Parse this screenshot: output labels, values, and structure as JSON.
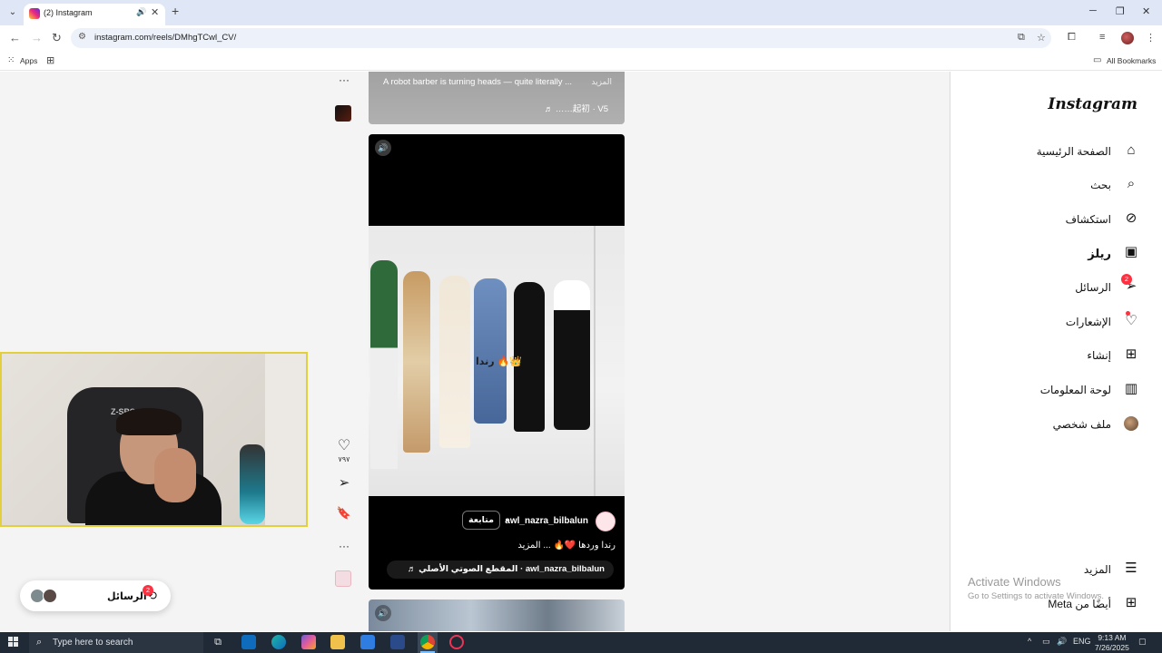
{
  "browser": {
    "tab_list_icon": "⌄",
    "tab_title": "(2) Instagram",
    "tab_audio_icon": "🔊",
    "tab_close": "✕",
    "new_tab": "+",
    "url": "instagram.com/reels/DMhgTCwl_CV/",
    "bookmarks": {
      "apps": "Apps",
      "all_bookmarks": "All Bookmarks"
    }
  },
  "sidebar": {
    "logo": "Instagram",
    "items": [
      {
        "label": "الصفحة الرئيسية",
        "icon": "home-icon",
        "glyph": "⌂"
      },
      {
        "label": "بحث",
        "icon": "search-icon",
        "glyph": "⌕"
      },
      {
        "label": "استكشاف",
        "icon": "compass-icon",
        "glyph": "⊘"
      },
      {
        "label": "ريلز",
        "icon": "reels-icon",
        "glyph": "▣"
      },
      {
        "label": "الرسائل",
        "icon": "messenger-icon",
        "glyph": "➢",
        "badge": "2"
      },
      {
        "label": "الإشعارات",
        "icon": "heart-icon",
        "glyph": "♡"
      },
      {
        "label": "إنشاء",
        "icon": "create-icon",
        "glyph": "⊞"
      },
      {
        "label": "لوحة المعلومات",
        "icon": "dashboard-icon",
        "glyph": "▥"
      },
      {
        "label": "ملف شخصي",
        "icon": "profile-avatar"
      }
    ],
    "more": {
      "label": "المزيد",
      "icon": "menu-icon",
      "glyph": "☰"
    },
    "also_from_meta": {
      "label": "أيضًا من Meta",
      "icon": "grid-icon",
      "glyph": "⊞"
    }
  },
  "windows_activation": {
    "title": "Activate Windows",
    "subtitle": "Go to Settings to activate Windows."
  },
  "previous_reel": {
    "caption": "A robot barber is turning heads — quite literally ...",
    "more": "المزيد",
    "audio": "♬ ……起初 · V5"
  },
  "current_reel": {
    "overlay_text": "رندا 🔥👑",
    "username": "awl_nazra_bilbalun",
    "follow": "متابعة",
    "separator": "•",
    "caption": "رندا وردها ❤️🔥 ... المزيد",
    "audio": "♬ المقطع الصوتي الأصلي · awl_nazra_bilbalun",
    "likes": "٧٩٧"
  },
  "side_actions": {
    "like_icon": "♡",
    "share_icon": "➢",
    "save_icon": "🔖",
    "more_icon": "···"
  },
  "messages_pill": {
    "label": "الرسائل",
    "badge": "2"
  },
  "taskbar": {
    "search_placeholder": "Type here to search",
    "lang": "ENG",
    "time": "9:13 AM",
    "date": "7/26/2025"
  },
  "colors": {
    "accent_badge": "#ff3040",
    "webcam_border": "#e3cf3c",
    "taskbar": "#1f2a36"
  }
}
